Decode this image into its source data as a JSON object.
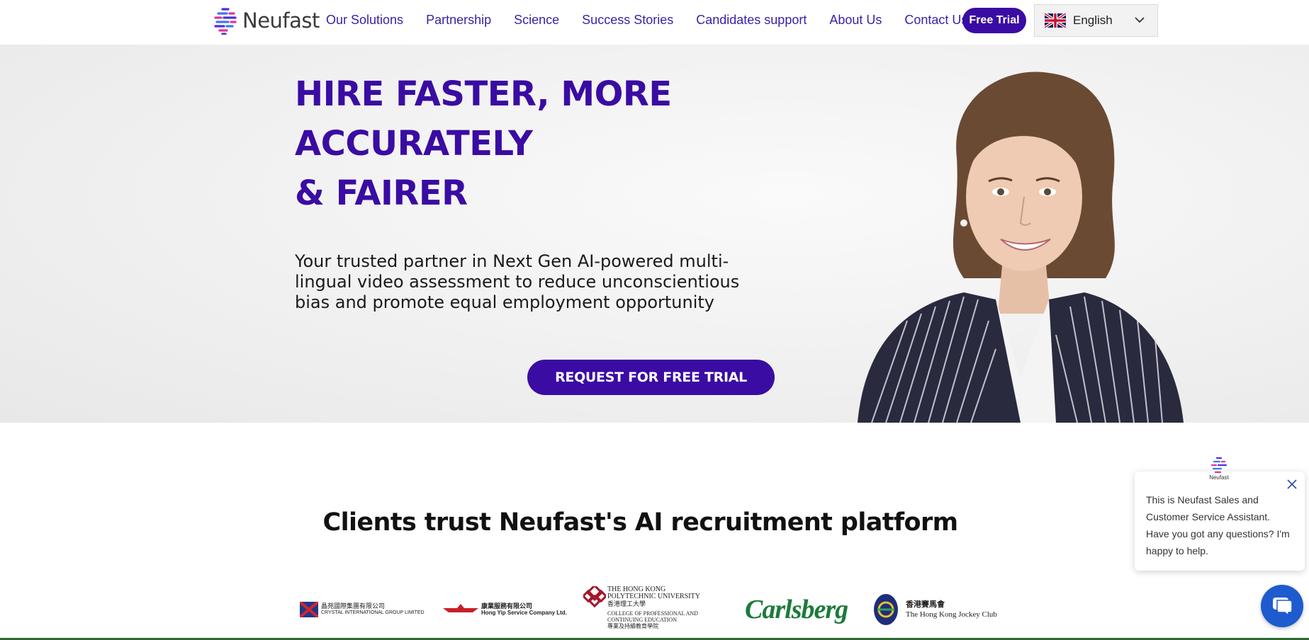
{
  "header": {
    "logo_text": "Neufast",
    "nav": [
      {
        "label": "Our Solutions"
      },
      {
        "label": "Partnership"
      },
      {
        "label": "Science"
      },
      {
        "label": "Success Stories"
      },
      {
        "label": "Candidates support"
      },
      {
        "label": "About Us"
      },
      {
        "label": "Contact Us"
      }
    ],
    "free_trial_label": "Free Trial",
    "language": {
      "selected": "English",
      "flag_icon": "uk-flag-icon"
    }
  },
  "hero": {
    "title_lines": [
      "HIRE FASTER, MORE",
      "ACCURATELY",
      "& FAIRER"
    ],
    "subtitle": "Your trusted partner in Next Gen AI-powered multi-lingual video assessment to reduce unconscientious bias and promote equal employment opportunity",
    "cta_label": "REQUEST FOR FREE TRIAL"
  },
  "clients": {
    "title": "Clients trust Neufast's AI recruitment platform",
    "logos": [
      {
        "name": "crystal-international",
        "lines": [
          "晶苑國際集團有限公司",
          "CRYSTAL INTERNATIONAL GROUP LIMITED"
        ]
      },
      {
        "name": "hong-yip",
        "lines": [
          "康業服務有限公司",
          "Hong Yip Service Company Ltd."
        ]
      },
      {
        "name": "polyu-cpce",
        "lines": [
          "THE HONG KONG",
          "POLYTECHNIC UNIVERSITY",
          "香港理工大學",
          "COLLEGE OF PROFESSIONAL AND",
          "CONTINUING EDUCATION",
          "專業及持續教育學院"
        ]
      },
      {
        "name": "carlsberg",
        "lines": [
          "Carlsberg"
        ]
      },
      {
        "name": "hkjc",
        "lines": [
          "香港賽馬會",
          "The Hong Kong Jockey Club"
        ]
      }
    ]
  },
  "chat": {
    "avatar_label": "Neufast",
    "message": "This is Neufast Sales and Customer Service Assistant. Have you got any questions? I'm happy to help."
  },
  "colors": {
    "brand": "#3a0ca3",
    "nav_text": "#3b1fa8",
    "chat_blue": "#1e5bcf"
  }
}
